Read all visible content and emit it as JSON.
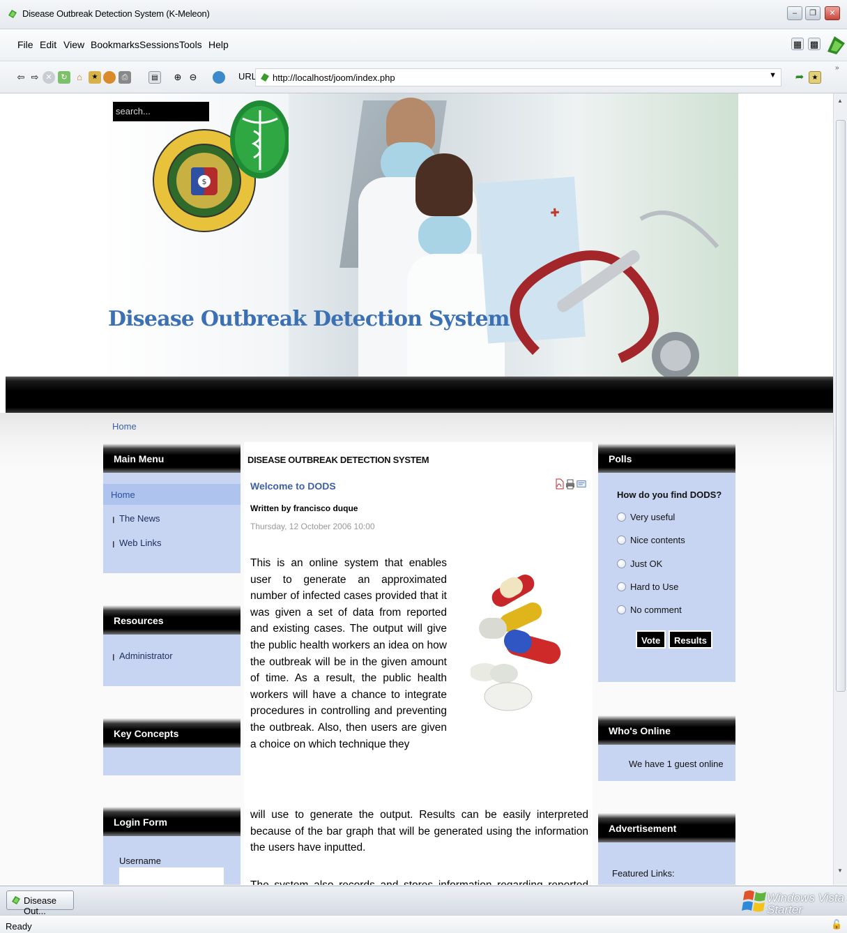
{
  "window": {
    "title": "Disease Outbreak Detection System (K-Meleon)"
  },
  "menubar": {
    "items": [
      "File",
      "Edit",
      "View",
      "Bookmarks",
      "Sessions",
      "Tools",
      "Help"
    ]
  },
  "navbar": {
    "url_label": "URL:",
    "url": "http://localhost/joom/index.php"
  },
  "page": {
    "search_placeholder": "search...",
    "site_title": "Disease Outbreak Detection System",
    "breadcrumb": "Home",
    "main_menu": {
      "title": "Main Menu",
      "items": [
        "Home",
        "The News",
        "Web Links"
      ]
    },
    "resources": {
      "title": "Resources",
      "items": [
        "Administrator"
      ]
    },
    "key_concepts": {
      "title": "Key Concepts"
    },
    "login": {
      "title": "Login Form",
      "username_label": "Username"
    },
    "article": {
      "section": "DISEASE OUTBREAK DETECTION SYSTEM",
      "title": "Welcome to DODS",
      "author": "Written by francisco duque",
      "date": "Thursday, 12 October 2006 10:00",
      "p1": "This is an online system that enables user to generate an approximated number of infected cases provided that it was given a set of data from reported and existing cases. The output will give the public health workers an idea on how the outbreak will be in the given amount of time. As a result, the public health workers will have a chance to integrate procedures in controlling and preventing the outbreak. Also, then users are given a choice on which technique they",
      "p2": "will use to generate the output. Results can be easily interpreted because of the bar graph that will be generated using the information the users have inputted.",
      "p3": "The system also records and stores information regarding reported cases indicating their personal information, location and condition. This will bring several benefits to the health workers because of faster retrieval of data that will be needed, more organize and clean reports because of easier updating and a faster response to the situation."
    },
    "polls": {
      "title": "Polls",
      "question": "How do you find DODS?",
      "options": [
        "Very useful",
        "Nice contents",
        "Just OK",
        "Hard to Use",
        "No comment"
      ],
      "vote_label": "Vote",
      "results_label": "Results"
    },
    "whos_online": {
      "title": "Who's Online",
      "text": "We have 1 guest online"
    },
    "advertisement": {
      "title": "Advertisement",
      "text": "Featured Links:"
    }
  },
  "taskbar": {
    "task_label": "Disease Out...",
    "os_brand": "Windows Vista",
    "os_edition": "Starter"
  },
  "status": {
    "text": "Ready"
  },
  "colors": {
    "title_blue": "#3c70b4",
    "module_body": "#c7d5f3",
    "menu_active": "#aec3ee"
  }
}
